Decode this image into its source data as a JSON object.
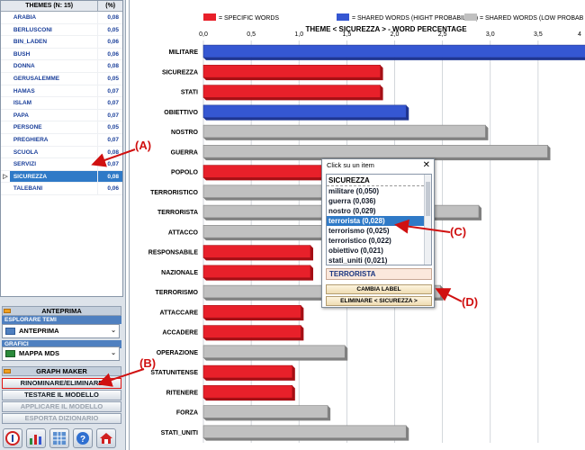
{
  "theme_table": {
    "header_theme": "THEMES (N: 15)",
    "header_pct": "(%)",
    "rows": [
      {
        "name": "ARABIA",
        "pct": "0,08"
      },
      {
        "name": "BERLUSCONI",
        "pct": "0,05"
      },
      {
        "name": "BIN_LADEN",
        "pct": "0,06"
      },
      {
        "name": "BUSH",
        "pct": "0,06"
      },
      {
        "name": "DONNA",
        "pct": "0,08"
      },
      {
        "name": "GERUSALEMME",
        "pct": "0,05"
      },
      {
        "name": "HAMAS",
        "pct": "0,07"
      },
      {
        "name": "ISLAM",
        "pct": "0,07"
      },
      {
        "name": "PAPA",
        "pct": "0,07"
      },
      {
        "name": "PERSONE",
        "pct": "0,05"
      },
      {
        "name": "PREGHIERA",
        "pct": "0,07"
      },
      {
        "name": "SCUOLA",
        "pct": "0,08"
      },
      {
        "name": "SERVIZI",
        "pct": "0,07"
      },
      {
        "name": "SICUREZZA",
        "pct": "0,08"
      },
      {
        "name": "TALEBANI",
        "pct": "0,06"
      }
    ],
    "selected_index": 13
  },
  "left_panel": {
    "anteprima_header": "ANTEPRIMA",
    "explore_label": "ESPLORARE TEMI",
    "explore_value": "ANTEPRIMA",
    "graph_label": "GRAFICI",
    "graph_value": "MAPPA MDS",
    "graph_maker_header": "GRAPH MAKER",
    "btn_rename": "RINOMINARE/ELIMINARE",
    "btn_test": "TESTARE IL MODELLO",
    "btn_apply": "APPLICARE IL MODELLO",
    "btn_export": "ESPORTA DIZIONARIO"
  },
  "toolbar": {
    "icons": [
      "info-icon",
      "chart-icon",
      "grid-icon",
      "help-icon",
      "home-icon"
    ]
  },
  "colors": {
    "specific": "#e8202a",
    "shared_high": "#3557d2",
    "shared_low": "#c0c0c0"
  },
  "legend": {
    "specific": "= SPECIFIC WORDS",
    "shared_high": "= SHARED WORDS (HIGHT PROBABILITY)",
    "shared_low": "= SHARED WORDS (LOW PROBAB"
  },
  "chart_data": {
    "type": "bar",
    "title": "THEME < SICUREZZA > - WORD PERCENTAGE",
    "orientation": "horizontal",
    "xlim": [
      0,
      4
    ],
    "x_ticks": [
      "0,0",
      "0,5",
      "1,0",
      "1,5",
      "2,0",
      "2,5",
      "3,0",
      "3,5",
      "4"
    ],
    "grid": true,
    "categories": [
      "MILITARE",
      "SICUREZZA",
      "STATI",
      "OBIETTIVO",
      "NOSTRO",
      "GUERRA",
      "POPOLO",
      "TERRORISTICO",
      "TERRORISTA",
      "ATTACCO",
      "RESPONSABILE",
      "NAZIONALE",
      "TERRORISMO",
      "ATTACCARE",
      "ACCADERE",
      "OPERAZIONE",
      "STATUNITENSE",
      "RITENERE",
      "FORZA",
      "STATI_UNITI"
    ],
    "values": [
      4.0,
      1.85,
      1.85,
      2.12,
      2.95,
      3.6,
      1.5,
      2.0,
      2.88,
      2.0,
      1.12,
      1.12,
      2.48,
      1.02,
      1.02,
      1.48,
      0.93,
      0.93,
      1.3,
      2.12
    ],
    "kinds": [
      "shared_high",
      "specific",
      "specific",
      "shared_high",
      "shared_low",
      "shared_low",
      "specific",
      "shared_low",
      "shared_low",
      "shared_low",
      "specific",
      "specific",
      "shared_low",
      "specific",
      "specific",
      "shared_low",
      "specific",
      "specific",
      "shared_low",
      "shared_low"
    ]
  },
  "popup": {
    "title": "Click su un item",
    "list_header": "SICUREZZA",
    "items": [
      "militare (0,050)",
      "guerra (0,036)",
      "nostro (0,029)",
      "terrorista (0,028)",
      "terrorismo (0,025)",
      "terroristico (0,022)",
      "obiettivo (0,021)",
      "stati_uniti (0,021)"
    ],
    "selected_index": 3,
    "label_value": "TERRORISTA",
    "btn_change": "CAMBIA LABEL",
    "btn_delete": "ELIMINARE < SICUREZZA >"
  },
  "annotations": {
    "a": "(A)",
    "b": "(B)",
    "c": "(C)",
    "d": "(D)"
  }
}
